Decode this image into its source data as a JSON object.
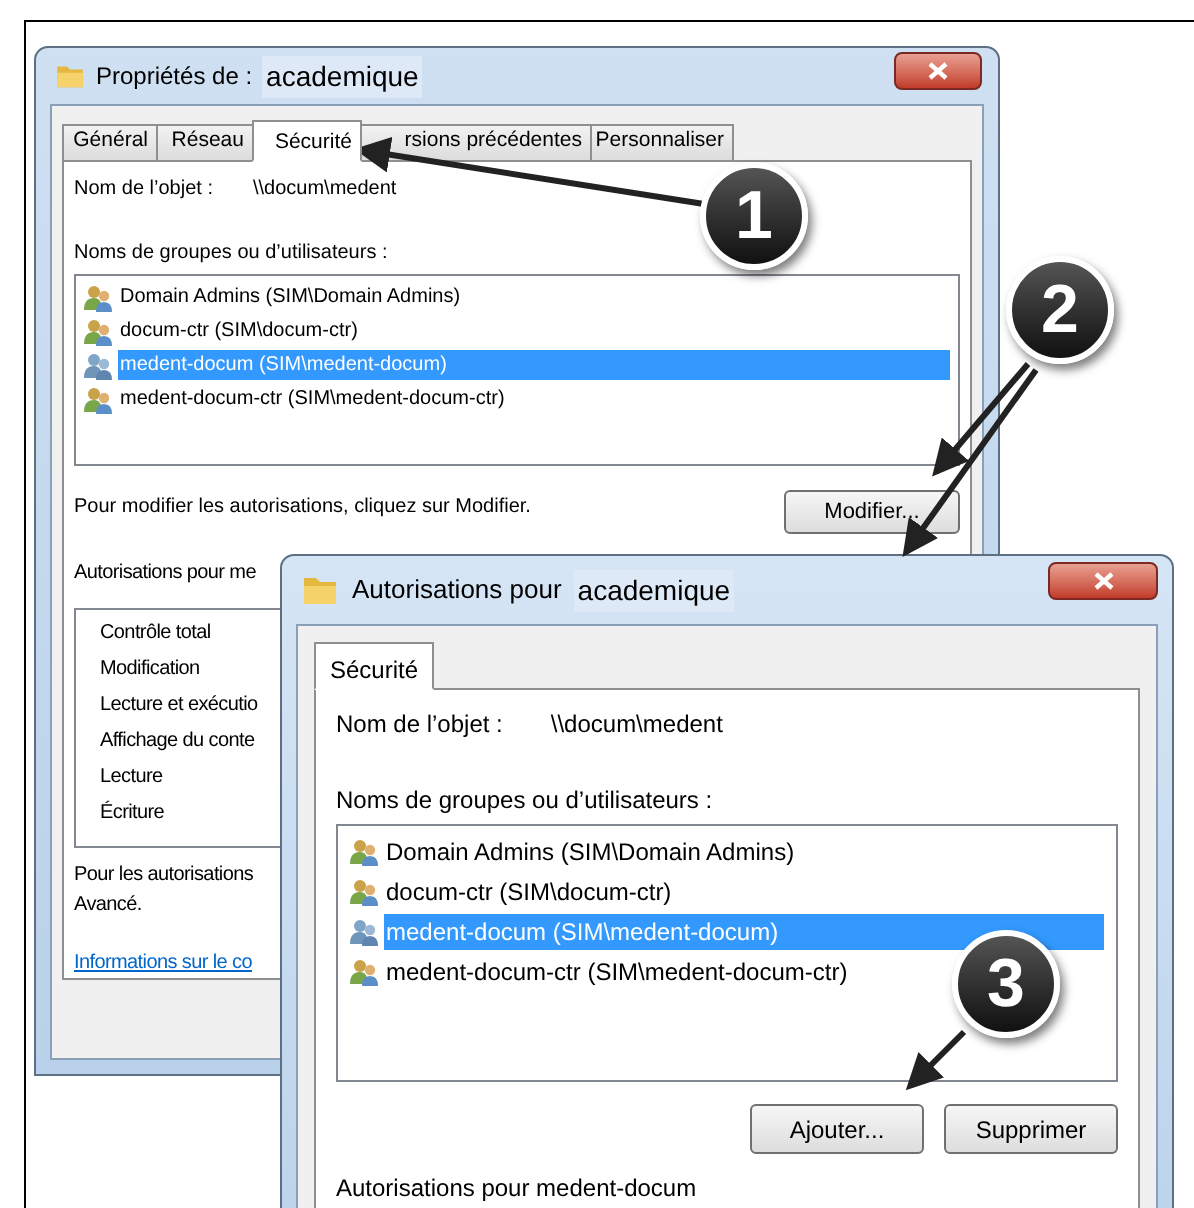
{
  "back_window": {
    "title_prefix": "Propriétés de :",
    "title_name": "academique",
    "tabs": [
      {
        "label": "Général",
        "selected": false
      },
      {
        "label": "Réseau",
        "selected": false
      },
      {
        "label": "Sécurité",
        "selected": true
      },
      {
        "label": "rsions précédentes",
        "selected": false
      },
      {
        "label": "Personnaliser",
        "selected": false
      }
    ],
    "object_label": "Nom de l’objet :",
    "object_value": "\\\\docum\\medent",
    "groups_label": "Noms de groupes ou d’utilisateurs :",
    "groups": [
      {
        "name": "Domain Admins (SIM\\Domain Admins)",
        "selected": false
      },
      {
        "name": "docum-ctr (SIM\\docum-ctr)",
        "selected": false
      },
      {
        "name": "medent-docum (SIM\\medent-docum)",
        "selected": true
      },
      {
        "name": "medent-docum-ctr (SIM\\medent-docum-ctr)",
        "selected": false
      }
    ],
    "modify_hint": "Pour modifier les autorisations, cliquez sur Modifier.",
    "modify_button": "Modifier...",
    "permissions_label": "Autorisations pour me",
    "permissions": [
      "Contrôle total",
      "Modification",
      "Lecture et exécutio",
      "Affichage du conte",
      "Lecture",
      "Écriture"
    ],
    "advanced_hint": [
      "Pour les autorisations",
      "Avancé."
    ],
    "info_link": "Informations sur le co"
  },
  "front_window": {
    "title_prefix": "Autorisations pour",
    "title_name": "academique",
    "tabs": [
      {
        "label": "Sécurité",
        "selected": true
      }
    ],
    "object_label": "Nom de l’objet :",
    "object_value": "\\\\docum\\medent",
    "groups_label": "Noms de groupes ou d’utilisateurs :",
    "groups": [
      {
        "name": "Domain Admins (SIM\\Domain Admins)",
        "selected": false
      },
      {
        "name": "docum-ctr (SIM\\docum-ctr)",
        "selected": false
      },
      {
        "name": "medent-docum (SIM\\medent-docum)",
        "selected": true
      },
      {
        "name": "medent-docum-ctr (SIM\\medent-docum-ctr)",
        "selected": false
      }
    ],
    "buttons": [
      "Ajouter...",
      "Supprimer"
    ],
    "permissions_label": "Autorisations pour medent-docum"
  },
  "annotations": [
    {
      "number": "1"
    },
    {
      "number": "2"
    },
    {
      "number": "3"
    }
  ]
}
